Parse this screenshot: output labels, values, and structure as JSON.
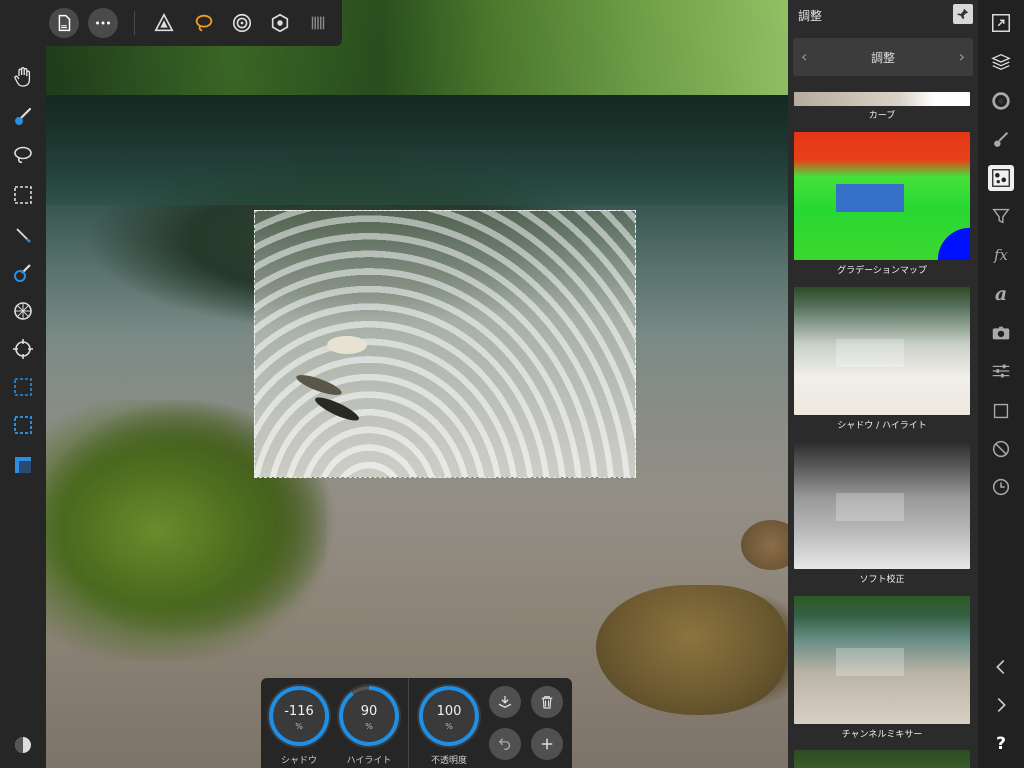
{
  "top_bar": {
    "icons": [
      "back-arrow-icon",
      "document-icon",
      "more-icon",
      "pixel-persona-icon",
      "lasso-persona-icon",
      "liquify-persona-icon",
      "develop-persona-icon",
      "export-persona-icon"
    ]
  },
  "left_toolbar": {
    "tools": [
      "view-hand-icon",
      "paint-brush-icon",
      "lasso-icon",
      "marquee-select-icon",
      "dropper-icon",
      "retouch-brush-icon",
      "burst-icon",
      "target-icon",
      "rect-select-icon",
      "rect-select-dashed-icon",
      "crop-overlay-icon",
      "color-swatch-icon"
    ]
  },
  "panel": {
    "title": "調整",
    "nav_label": "調整",
    "prev_symbol": "‹",
    "next_symbol": "›",
    "items": [
      {
        "label": "カーブ"
      },
      {
        "label": "グラデーションマップ"
      },
      {
        "label": "シャドウ / ハイライト"
      },
      {
        "label": "ソフト校正"
      },
      {
        "label": "チャンネルミキサー"
      }
    ]
  },
  "iconbar": {
    "icons": [
      "navigator-icon",
      "layers-icon",
      "color-wheel-icon",
      "brushes-icon",
      "adjustments-icon",
      "filter-icon",
      "fx-icon",
      "text-icon",
      "camera-icon",
      "sliders-icon",
      "transform-icon",
      "no-entry-icon",
      "history-icon",
      "chevron-left-icon",
      "chevron-right-icon",
      "help-icon"
    ],
    "help_label": "?",
    "fx_label": "fx",
    "text_label": "a"
  },
  "context_bar": {
    "shadows": {
      "value": "-116",
      "unit": "%",
      "label": "シャドウ",
      "level": -1.16
    },
    "highlights": {
      "value": "90",
      "unit": "%",
      "label": "ハイライト",
      "level": 0.9
    },
    "opacity": {
      "value": "100",
      "unit": "%",
      "label": "不透明度",
      "level": 1.0
    },
    "buttons": [
      "merge-down-icon",
      "trash-icon",
      "undo-icon",
      "add-icon"
    ]
  },
  "colors": {
    "accent": "#1e8fe6",
    "panel_bg": "#2b2b2b",
    "toolbar_bg": "#262626"
  }
}
